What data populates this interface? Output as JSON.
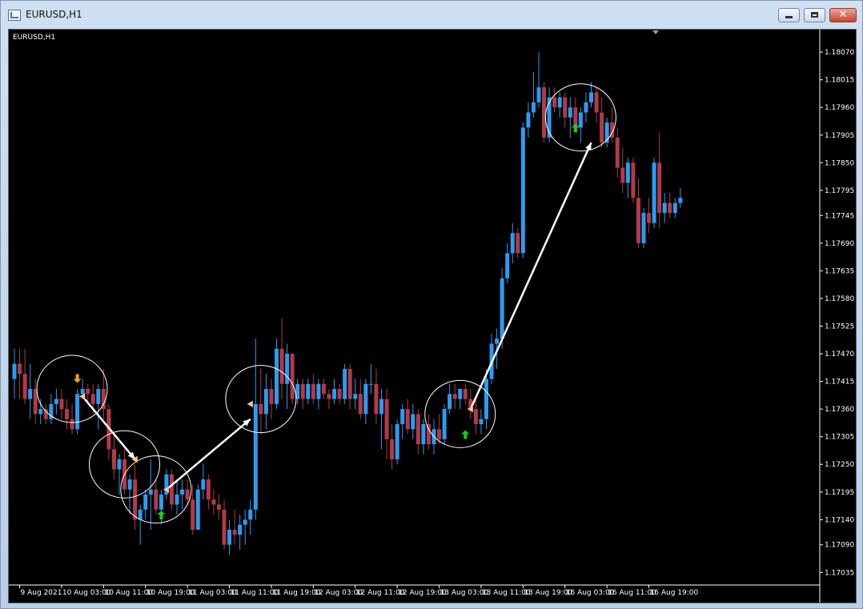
{
  "window": {
    "title": "EURUSD,H1",
    "app_icon": "chart-window-icon",
    "buttons": {
      "minimize": "minimize-icon",
      "maximize": "maximize-icon",
      "close": "close-icon",
      "close_glyph": "✕"
    }
  },
  "chart_data": {
    "type": "candlestick",
    "title": "EURUSD,H1",
    "symbol": "EURUSD",
    "timeframe": "H1",
    "background": "#000000",
    "colors": {
      "bull": "#2c9cf0",
      "bear": "#b23a48",
      "axis_text": "#ffffff",
      "annotation": "#ffffff",
      "arrow_up": "#18d018",
      "arrow_down": "#f0a020",
      "marker": "#f2c8a6"
    },
    "ylim": [
      1.1701,
      1.1811
    ],
    "y_ticks": [
      "1.18070",
      "1.18015",
      "1.17960",
      "1.17905",
      "1.17850",
      "1.17795",
      "1.17745",
      "1.17690",
      "1.17635",
      "1.17580",
      "1.17525",
      "1.17470",
      "1.17415",
      "1.17360",
      "1.17305",
      "1.17250",
      "1.17195",
      "1.17140",
      "1.17090",
      "1.17035"
    ],
    "x_ticks": [
      "9 Aug 2021",
      "10 Aug 03:00",
      "10 Aug 11:00",
      "10 Aug 19:00",
      "11 Aug 03:00",
      "11 Aug 11:00",
      "11 Aug 19:00",
      "12 Aug 03:00",
      "12 Aug 11:00",
      "12 Aug 19:00",
      "13 Aug 03:00",
      "13 Aug 11:00",
      "13 Aug 19:00",
      "16 Aug 03:00",
      "16 Aug 11:00",
      "16 Aug 19:00"
    ],
    "candles": [
      {
        "t": "9 Aug 2021 16:00",
        "o": 1.1742,
        "h": 1.1748,
        "l": 1.1738,
        "c": 1.1745
      },
      {
        "t": "9 Aug 17:00",
        "o": 1.1745,
        "h": 1.1748,
        "l": 1.1738,
        "c": 1.1743
      },
      {
        "t": "9 Aug 18:00",
        "o": 1.1743,
        "h": 1.1748,
        "l": 1.1737,
        "c": 1.1738
      },
      {
        "t": "9 Aug 19:00",
        "o": 1.1738,
        "h": 1.1745,
        "l": 1.1734,
        "c": 1.174
      },
      {
        "t": "9 Aug 20:00",
        "o": 1.174,
        "h": 1.1742,
        "l": 1.1733,
        "c": 1.1735
      },
      {
        "t": "9 Aug 21:00",
        "o": 1.1735,
        "h": 1.1738,
        "l": 1.1733,
        "c": 1.1736
      },
      {
        "t": "9 Aug 22:00",
        "o": 1.1736,
        "h": 1.1737,
        "l": 1.1733,
        "c": 1.1734
      },
      {
        "t": "9 Aug 23:00",
        "o": 1.1734,
        "h": 1.1739,
        "l": 1.1733,
        "c": 1.1737
      },
      {
        "t": "10 Aug 00:00",
        "o": 1.1737,
        "h": 1.174,
        "l": 1.1735,
        "c": 1.1738
      },
      {
        "t": "10 Aug 01:00",
        "o": 1.1738,
        "h": 1.174,
        "l": 1.1734,
        "c": 1.1736
      },
      {
        "t": "10 Aug 02:00",
        "o": 1.1736,
        "h": 1.1738,
        "l": 1.1732,
        "c": 1.1734
      },
      {
        "t": "10 Aug 03:00",
        "o": 1.1734,
        "h": 1.1737,
        "l": 1.1731,
        "c": 1.1732
      },
      {
        "t": "10 Aug 04:00",
        "o": 1.1732,
        "h": 1.174,
        "l": 1.1731,
        "c": 1.1739
      },
      {
        "t": "10 Aug 05:00",
        "o": 1.1739,
        "h": 1.1742,
        "l": 1.1738,
        "c": 1.174
      },
      {
        "t": "10 Aug 06:00",
        "o": 1.174,
        "h": 1.1741,
        "l": 1.1737,
        "c": 1.1739
      },
      {
        "t": "10 Aug 07:00",
        "o": 1.1739,
        "h": 1.1741,
        "l": 1.1735,
        "c": 1.1737
      },
      {
        "t": "10 Aug 08:00",
        "o": 1.1737,
        "h": 1.1741,
        "l": 1.1732,
        "c": 1.174
      },
      {
        "t": "10 Aug 09:00",
        "o": 1.174,
        "h": 1.1744,
        "l": 1.1734,
        "c": 1.1736
      },
      {
        "t": "10 Aug 10:00",
        "o": 1.1736,
        "h": 1.1737,
        "l": 1.1726,
        "c": 1.1728
      },
      {
        "t": "10 Aug 11:00",
        "o": 1.1728,
        "h": 1.1731,
        "l": 1.1722,
        "c": 1.1724
      },
      {
        "t": "10 Aug 12:00",
        "o": 1.1724,
        "h": 1.1727,
        "l": 1.1719,
        "c": 1.1726
      },
      {
        "t": "10 Aug 13:00",
        "o": 1.1726,
        "h": 1.1728,
        "l": 1.1719,
        "c": 1.172
      },
      {
        "t": "10 Aug 14:00",
        "o": 1.172,
        "h": 1.1723,
        "l": 1.1715,
        "c": 1.1722
      },
      {
        "t": "10 Aug 15:00",
        "o": 1.1722,
        "h": 1.1725,
        "l": 1.1712,
        "c": 1.1714
      },
      {
        "t": "10 Aug 16:00",
        "o": 1.1714,
        "h": 1.1717,
        "l": 1.1709,
        "c": 1.1716
      },
      {
        "t": "10 Aug 17:00",
        "o": 1.1716,
        "h": 1.172,
        "l": 1.1714,
        "c": 1.1719
      },
      {
        "t": "10 Aug 18:00",
        "o": 1.1719,
        "h": 1.1726,
        "l": 1.1712,
        "c": 1.172
      },
      {
        "t": "10 Aug 19:00",
        "o": 1.172,
        "h": 1.1722,
        "l": 1.1715,
        "c": 1.1716
      },
      {
        "t": "10 Aug 20:00",
        "o": 1.1716,
        "h": 1.172,
        "l": 1.1713,
        "c": 1.1719
      },
      {
        "t": "10 Aug 21:00",
        "o": 1.1719,
        "h": 1.1724,
        "l": 1.1718,
        "c": 1.1723
      },
      {
        "t": "10 Aug 22:00",
        "o": 1.1723,
        "h": 1.1724,
        "l": 1.1716,
        "c": 1.1717
      },
      {
        "t": "10 Aug 23:00",
        "o": 1.1717,
        "h": 1.1722,
        "l": 1.1715,
        "c": 1.1719
      },
      {
        "t": "11 Aug 00:00",
        "o": 1.1719,
        "h": 1.1722,
        "l": 1.1716,
        "c": 1.172
      },
      {
        "t": "11 Aug 01:00",
        "o": 1.172,
        "h": 1.1722,
        "l": 1.1717,
        "c": 1.1718
      },
      {
        "t": "11 Aug 02:00",
        "o": 1.1718,
        "h": 1.1721,
        "l": 1.1711,
        "c": 1.1712
      },
      {
        "t": "11 Aug 03:00",
        "o": 1.1712,
        "h": 1.1721,
        "l": 1.1712,
        "c": 1.172
      },
      {
        "t": "11 Aug 04:00",
        "o": 1.172,
        "h": 1.1725,
        "l": 1.1718,
        "c": 1.1722
      },
      {
        "t": "11 Aug 05:00",
        "o": 1.1722,
        "h": 1.1723,
        "l": 1.1716,
        "c": 1.1718
      },
      {
        "t": "11 Aug 06:00",
        "o": 1.1718,
        "h": 1.172,
        "l": 1.1715,
        "c": 1.1717
      },
      {
        "t": "11 Aug 07:00",
        "o": 1.1717,
        "h": 1.1719,
        "l": 1.1714,
        "c": 1.1716
      },
      {
        "t": "11 Aug 08:00",
        "o": 1.1716,
        "h": 1.1718,
        "l": 1.1708,
        "c": 1.1709
      },
      {
        "t": "11 Aug 09:00",
        "o": 1.1709,
        "h": 1.1714,
        "l": 1.1707,
        "c": 1.1712
      },
      {
        "t": "11 Aug 10:00",
        "o": 1.1712,
        "h": 1.1716,
        "l": 1.1709,
        "c": 1.1711
      },
      {
        "t": "11 Aug 11:00",
        "o": 1.1711,
        "h": 1.1715,
        "l": 1.1708,
        "c": 1.1713
      },
      {
        "t": "11 Aug 12:00",
        "o": 1.1713,
        "h": 1.1716,
        "l": 1.1709,
        "c": 1.1714
      },
      {
        "t": "11 Aug 13:00",
        "o": 1.1714,
        "h": 1.1718,
        "l": 1.1711,
        "c": 1.1716
      },
      {
        "t": "11 Aug 14:00",
        "o": 1.1716,
        "h": 1.175,
        "l": 1.1714,
        "c": 1.1737
      },
      {
        "t": "11 Aug 15:00",
        "o": 1.1737,
        "h": 1.1744,
        "l": 1.1731,
        "c": 1.1735
      },
      {
        "t": "11 Aug 16:00",
        "o": 1.1735,
        "h": 1.1743,
        "l": 1.1732,
        "c": 1.174
      },
      {
        "t": "11 Aug 17:00",
        "o": 1.174,
        "h": 1.1742,
        "l": 1.1734,
        "c": 1.1737
      },
      {
        "t": "11 Aug 18:00",
        "o": 1.1737,
        "h": 1.175,
        "l": 1.1736,
        "c": 1.1748
      },
      {
        "t": "11 Aug 19:00",
        "o": 1.1748,
        "h": 1.1754,
        "l": 1.1738,
        "c": 1.1741
      },
      {
        "t": "11 Aug 20:00",
        "o": 1.1741,
        "h": 1.1749,
        "l": 1.1736,
        "c": 1.1747
      },
      {
        "t": "11 Aug 21:00",
        "o": 1.1747,
        "h": 1.1747,
        "l": 1.1737,
        "c": 1.1738
      },
      {
        "t": "11 Aug 22:00",
        "o": 1.1738,
        "h": 1.1742,
        "l": 1.1737,
        "c": 1.1741
      },
      {
        "t": "11 Aug 23:00",
        "o": 1.1741,
        "h": 1.1742,
        "l": 1.1736,
        "c": 1.1738
      },
      {
        "t": "12 Aug 00:00",
        "o": 1.1738,
        "h": 1.1742,
        "l": 1.1737,
        "c": 1.1741
      },
      {
        "t": "12 Aug 01:00",
        "o": 1.1741,
        "h": 1.1743,
        "l": 1.1737,
        "c": 1.1738
      },
      {
        "t": "12 Aug 02:00",
        "o": 1.1738,
        "h": 1.1742,
        "l": 1.1736,
        "c": 1.1741
      },
      {
        "t": "12 Aug 03:00",
        "o": 1.1741,
        "h": 1.1742,
        "l": 1.1738,
        "c": 1.1739
      },
      {
        "t": "12 Aug 04:00",
        "o": 1.1739,
        "h": 1.174,
        "l": 1.1736,
        "c": 1.1738
      },
      {
        "t": "12 Aug 05:00",
        "o": 1.1738,
        "h": 1.1742,
        "l": 1.1737,
        "c": 1.174
      },
      {
        "t": "12 Aug 06:00",
        "o": 1.174,
        "h": 1.1741,
        "l": 1.1737,
        "c": 1.1738
      },
      {
        "t": "12 Aug 07:00",
        "o": 1.1738,
        "h": 1.1745,
        "l": 1.1737,
        "c": 1.1744
      },
      {
        "t": "12 Aug 08:00",
        "o": 1.1744,
        "h": 1.1745,
        "l": 1.1736,
        "c": 1.1738
      },
      {
        "t": "12 Aug 09:00",
        "o": 1.1738,
        "h": 1.1742,
        "l": 1.1736,
        "c": 1.1739
      },
      {
        "t": "12 Aug 10:00",
        "o": 1.1739,
        "h": 1.1742,
        "l": 1.1734,
        "c": 1.1735
      },
      {
        "t": "12 Aug 11:00",
        "o": 1.1735,
        "h": 1.1742,
        "l": 1.1733,
        "c": 1.1741
      },
      {
        "t": "12 Aug 12:00",
        "o": 1.1741,
        "h": 1.1745,
        "l": 1.1739,
        "c": 1.1741
      },
      {
        "t": "12 Aug 13:00",
        "o": 1.1741,
        "h": 1.1744,
        "l": 1.1733,
        "c": 1.1735
      },
      {
        "t": "12 Aug 14:00",
        "o": 1.1735,
        "h": 1.174,
        "l": 1.1728,
        "c": 1.1738
      },
      {
        "t": "12 Aug 15:00",
        "o": 1.1738,
        "h": 1.174,
        "l": 1.1726,
        "c": 1.173
      },
      {
        "t": "12 Aug 16:00",
        "o": 1.173,
        "h": 1.1733,
        "l": 1.1724,
        "c": 1.1726
      },
      {
        "t": "12 Aug 17:00",
        "o": 1.1726,
        "h": 1.1734,
        "l": 1.1725,
        "c": 1.1733
      },
      {
        "t": "12 Aug 18:00",
        "o": 1.1733,
        "h": 1.1737,
        "l": 1.173,
        "c": 1.1736
      },
      {
        "t": "12 Aug 19:00",
        "o": 1.1736,
        "h": 1.1738,
        "l": 1.1731,
        "c": 1.1732
      },
      {
        "t": "12 Aug 20:00",
        "o": 1.1732,
        "h": 1.1737,
        "l": 1.173,
        "c": 1.1735
      },
      {
        "t": "12 Aug 21:00",
        "o": 1.1735,
        "h": 1.1736,
        "l": 1.1727,
        "c": 1.1729
      },
      {
        "t": "12 Aug 22:00",
        "o": 1.1729,
        "h": 1.1734,
        "l": 1.1727,
        "c": 1.1733
      },
      {
        "t": "12 Aug 23:00",
        "o": 1.1733,
        "h": 1.1735,
        "l": 1.1728,
        "c": 1.1729
      },
      {
        "t": "13 Aug 00:00",
        "o": 1.1729,
        "h": 1.1734,
        "l": 1.1727,
        "c": 1.1732
      },
      {
        "t": "13 Aug 01:00",
        "o": 1.1732,
        "h": 1.1735,
        "l": 1.1729,
        "c": 1.173
      },
      {
        "t": "13 Aug 02:00",
        "o": 1.173,
        "h": 1.1737,
        "l": 1.1729,
        "c": 1.1736
      },
      {
        "t": "13 Aug 03:00",
        "o": 1.1736,
        "h": 1.1741,
        "l": 1.1735,
        "c": 1.1739
      },
      {
        "t": "13 Aug 04:00",
        "o": 1.1739,
        "h": 1.1741,
        "l": 1.1736,
        "c": 1.1738
      },
      {
        "t": "13 Aug 05:00",
        "o": 1.1738,
        "h": 1.174,
        "l": 1.1736,
        "c": 1.174
      },
      {
        "t": "13 Aug 06:00",
        "o": 1.174,
        "h": 1.1741,
        "l": 1.1737,
        "c": 1.1738
      },
      {
        "t": "13 Aug 07:00",
        "o": 1.1738,
        "h": 1.174,
        "l": 1.1734,
        "c": 1.1736
      },
      {
        "t": "13 Aug 08:00",
        "o": 1.1736,
        "h": 1.1738,
        "l": 1.1731,
        "c": 1.1733
      },
      {
        "t": "13 Aug 09:00",
        "o": 1.1733,
        "h": 1.1736,
        "l": 1.1731,
        "c": 1.1734
      },
      {
        "t": "13 Aug 10:00",
        "o": 1.1734,
        "h": 1.1744,
        "l": 1.1732,
        "c": 1.1742
      },
      {
        "t": "13 Aug 11:00",
        "o": 1.1742,
        "h": 1.1751,
        "l": 1.1741,
        "c": 1.1749
      },
      {
        "t": "13 Aug 12:00",
        "o": 1.1749,
        "h": 1.1752,
        "l": 1.1744,
        "c": 1.175
      },
      {
        "t": "13 Aug 13:00",
        "o": 1.175,
        "h": 1.1764,
        "l": 1.1748,
        "c": 1.1762
      },
      {
        "t": "13 Aug 14:00",
        "o": 1.1762,
        "h": 1.1769,
        "l": 1.1761,
        "c": 1.1767
      },
      {
        "t": "13 Aug 15:00",
        "o": 1.1767,
        "h": 1.1773,
        "l": 1.1765,
        "c": 1.1771
      },
      {
        "t": "13 Aug 16:00",
        "o": 1.1771,
        "h": 1.1772,
        "l": 1.1766,
        "c": 1.1767
      },
      {
        "t": "13 Aug 17:00",
        "o": 1.1767,
        "h": 1.1793,
        "l": 1.1766,
        "c": 1.1792
      },
      {
        "t": "13 Aug 18:00",
        "o": 1.1792,
        "h": 1.1797,
        "l": 1.179,
        "c": 1.1795
      },
      {
        "t": "13 Aug 19:00",
        "o": 1.1795,
        "h": 1.1803,
        "l": 1.1794,
        "c": 1.1797
      },
      {
        "t": "13 Aug 20:00",
        "o": 1.1797,
        "h": 1.1807,
        "l": 1.1796,
        "c": 1.18
      },
      {
        "t": "13 Aug 21:00",
        "o": 1.18,
        "h": 1.1801,
        "l": 1.1789,
        "c": 1.179
      },
      {
        "t": "13 Aug 22:00",
        "o": 1.179,
        "h": 1.18,
        "l": 1.1789,
        "c": 1.1798
      },
      {
        "t": "13 Aug 23:00",
        "o": 1.1798,
        "h": 1.18,
        "l": 1.1795,
        "c": 1.1796
      },
      {
        "t": "16 Aug 00:00",
        "o": 1.1796,
        "h": 1.1799,
        "l": 1.1794,
        "c": 1.1798
      },
      {
        "t": "16 Aug 01:00",
        "o": 1.1798,
        "h": 1.1799,
        "l": 1.1792,
        "c": 1.1794
      },
      {
        "t": "16 Aug 02:00",
        "o": 1.1794,
        "h": 1.1798,
        "l": 1.179,
        "c": 1.1796
      },
      {
        "t": "16 Aug 03:00",
        "o": 1.1796,
        "h": 1.1798,
        "l": 1.1791,
        "c": 1.1792
      },
      {
        "t": "16 Aug 04:00",
        "o": 1.1792,
        "h": 1.1796,
        "l": 1.1789,
        "c": 1.1795
      },
      {
        "t": "16 Aug 05:00",
        "o": 1.1795,
        "h": 1.1799,
        "l": 1.1793,
        "c": 1.1797
      },
      {
        "t": "16 Aug 06:00",
        "o": 1.1797,
        "h": 1.1801,
        "l": 1.1796,
        "c": 1.1799
      },
      {
        "t": "16 Aug 07:00",
        "o": 1.1799,
        "h": 1.18,
        "l": 1.1793,
        "c": 1.1795
      },
      {
        "t": "16 Aug 08:00",
        "o": 1.1795,
        "h": 1.1798,
        "l": 1.1788,
        "c": 1.1789
      },
      {
        "t": "16 Aug 09:00",
        "o": 1.1789,
        "h": 1.1794,
        "l": 1.1788,
        "c": 1.1793
      },
      {
        "t": "16 Aug 10:00",
        "o": 1.1793,
        "h": 1.1796,
        "l": 1.1789,
        "c": 1.179
      },
      {
        "t": "16 Aug 11:00",
        "o": 1.179,
        "h": 1.1792,
        "l": 1.1782,
        "c": 1.1784
      },
      {
        "t": "16 Aug 12:00",
        "o": 1.1784,
        "h": 1.1788,
        "l": 1.1779,
        "c": 1.1781
      },
      {
        "t": "16 Aug 13:00",
        "o": 1.1781,
        "h": 1.1786,
        "l": 1.1778,
        "c": 1.1785
      },
      {
        "t": "16 Aug 14:00",
        "o": 1.1785,
        "h": 1.1786,
        "l": 1.1777,
        "c": 1.1778
      },
      {
        "t": "16 Aug 15:00",
        "o": 1.1778,
        "h": 1.1782,
        "l": 1.1768,
        "c": 1.1769
      },
      {
        "t": "16 Aug 16:00",
        "o": 1.1769,
        "h": 1.1776,
        "l": 1.1768,
        "c": 1.1775
      },
      {
        "t": "16 Aug 17:00",
        "o": 1.1775,
        "h": 1.1778,
        "l": 1.1771,
        "c": 1.1773
      },
      {
        "t": "16 Aug 18:00",
        "o": 1.1773,
        "h": 1.1786,
        "l": 1.1772,
        "c": 1.1785
      },
      {
        "t": "16 Aug 19:00",
        "o": 1.1785,
        "h": 1.1791,
        "l": 1.1772,
        "c": 1.1775
      },
      {
        "t": "16 Aug 20:00",
        "o": 1.1775,
        "h": 1.1779,
        "l": 1.1773,
        "c": 1.1777
      },
      {
        "t": "16 Aug 21:00",
        "o": 1.1777,
        "h": 1.1779,
        "l": 1.1774,
        "c": 1.1775
      },
      {
        "t": "16 Aug 22:00",
        "o": 1.1775,
        "h": 1.1778,
        "l": 1.1774,
        "c": 1.1777
      },
      {
        "t": "16 Aug 23:00",
        "o": 1.1777,
        "h": 1.178,
        "l": 1.1776,
        "c": 1.1778
      }
    ],
    "circles": [
      {
        "index": 11,
        "price": 1.174
      },
      {
        "index": 21,
        "price": 1.1725
      },
      {
        "index": 27,
        "price": 1.172
      },
      {
        "index": 47,
        "price": 1.1738
      },
      {
        "index": 85,
        "price": 1.1735
      },
      {
        "index": 108,
        "price": 1.1794
      }
    ],
    "arrows": [
      {
        "from": {
          "index": 13,
          "price": 1.17385
        },
        "to": {
          "index": 23,
          "price": 1.1726
        }
      },
      {
        "from": {
          "index": 29,
          "price": 1.172
        },
        "to": {
          "index": 45,
          "price": 1.1734
        }
      },
      {
        "from": {
          "index": 87,
          "price": 1.1736
        },
        "to": {
          "index": 110,
          "price": 1.1789
        }
      }
    ],
    "signals": [
      {
        "index": 12,
        "price": 1.1742,
        "type": "down"
      },
      {
        "index": 28,
        "price": 1.1715,
        "type": "up"
      },
      {
        "index": 86,
        "price": 1.1731,
        "type": "up"
      },
      {
        "index": 107,
        "price": 1.1792,
        "type": "up"
      }
    ],
    "markers": [
      {
        "index": 13,
        "price": 1.17385
      },
      {
        "index": 23,
        "price": 1.1726
      },
      {
        "index": 29,
        "price": 1.172
      },
      {
        "index": 45,
        "price": 1.1737
      },
      {
        "index": 87,
        "price": 1.1736
      }
    ]
  }
}
